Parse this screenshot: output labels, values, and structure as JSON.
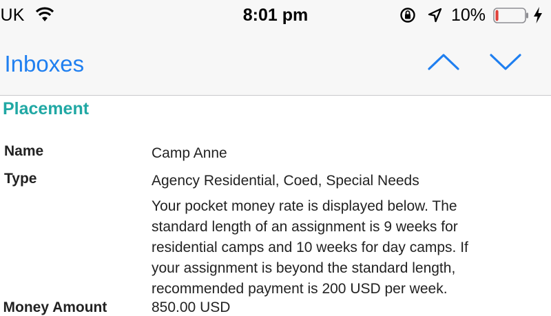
{
  "status_bar": {
    "carrier": "-UK",
    "time": "8:01 pm",
    "battery_percent": "10%",
    "battery_level": 0.1,
    "battery_color": "#e0413a"
  },
  "nav": {
    "back_label": "l Inboxes",
    "up_icon": "chevron-up-icon",
    "down_icon": "chevron-down-icon",
    "accent": "#1f7ff0"
  },
  "placement": {
    "section_title": "Placement",
    "name_label": "Name",
    "name_value": "Camp Anne",
    "type_label": "Type",
    "type_value": "Agency Residential, Coed, Special Needs",
    "description_lines": [
      "Your pocket money rate is displayed below. The",
      "standard length of an assignment is 9 weeks for",
      "residential camps and 10 weeks for day camps. If",
      "your assignment is beyond the standard length,",
      "recommended payment is 200 USD per week."
    ],
    "amount_label_partial": "et Money Amount",
    "amount_value_partial": "850.00 USD",
    "section_color": "#20a8a4"
  }
}
